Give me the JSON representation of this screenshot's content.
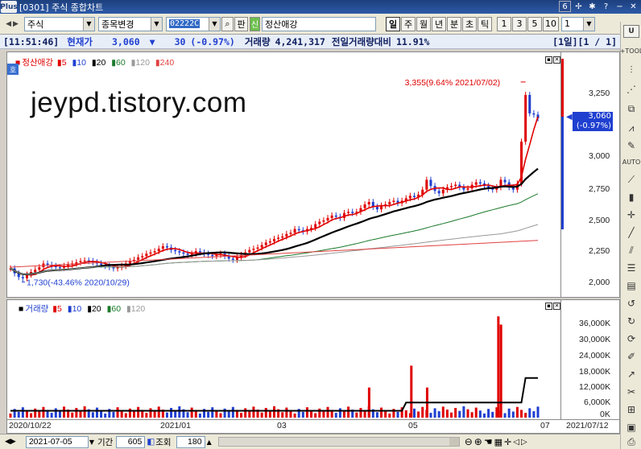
{
  "window": {
    "title": "[0301] 주식 종합차트",
    "logo": "Plus",
    "badge": "6"
  },
  "toolbar": {
    "market": "주식",
    "action": "종목변경",
    "code": "02222C",
    "pan_label": "판",
    "credit_badge": "신",
    "stock_name": "정산애강",
    "periods": [
      "일",
      "주",
      "월",
      "년",
      "분",
      "초",
      "틱"
    ],
    "active_period": "일",
    "multipliers": [
      "1",
      "3",
      "5",
      "10"
    ],
    "unit_value": "1"
  },
  "infobar": {
    "time": "[11:51:46]",
    "price_label": "현재가",
    "price": "3,060",
    "arrow": "▼",
    "change": "30",
    "change_pct": "(-0.97%)",
    "volume_label": "거래량",
    "volume": "4,241,317",
    "prev_ratio_label": "전일거래량대비",
    "prev_ratio": "11.91%",
    "page": "[1일][1 / 1]"
  },
  "price_panel": {
    "side_tag": "호",
    "legend_name": "정산애강",
    "ma": [
      {
        "label": "5",
        "color": "#e00000"
      },
      {
        "label": "10",
        "color": "#1f3fd0"
      },
      {
        "label": "20",
        "color": "#000000"
      },
      {
        "label": "60",
        "color": "#1a7a2a"
      },
      {
        "label": "120",
        "color": "#999999"
      },
      {
        "label": "240",
        "color": "#e04040"
      }
    ],
    "watermark": "jeypd.tistory.com",
    "high_annotation": "3,355(9.64% 2021/07/02)",
    "low_annotation": "1,730(-43.46% 2020/10/29)",
    "current_price_tag": "3,060",
    "current_pct_tag": "(-0.97%)",
    "y_ticks": [
      "3,250",
      "3,000",
      "2,750",
      "2,500",
      "2,250",
      "2,000",
      "1,750"
    ]
  },
  "volume_panel": {
    "legend_name": "거래량",
    "ma": [
      {
        "label": "5",
        "color": "#e00000"
      },
      {
        "label": "10",
        "color": "#1f3fd0"
      },
      {
        "label": "20",
        "color": "#000000"
      },
      {
        "label": "60",
        "color": "#1a7a2a"
      },
      {
        "label": "120",
        "color": "#999999"
      }
    ],
    "y_ticks": [
      "36,000K",
      "30,000K",
      "24,000K",
      "18,000K",
      "12,000K",
      "6,000K",
      "0K"
    ]
  },
  "x_axis": {
    "labels": [
      "2020/10/22",
      "2021/01",
      "03",
      "05",
      "07",
      "2021/07/12"
    ]
  },
  "bottombar": {
    "date": "2021-07-05",
    "period_label": "기간",
    "period_value": "605",
    "query_label": "조회",
    "query_value": "180"
  },
  "chart_data": {
    "type": "candlestick",
    "title": "정산애강",
    "x_range": [
      "2020/10/22",
      "2021/07/12"
    ],
    "ylim": [
      1700,
      3400
    ],
    "current_price": 3060,
    "high": {
      "value": 3355,
      "pct": 9.64,
      "date": "2021/07/02"
    },
    "low": {
      "value": 1730,
      "pct": -43.46,
      "date": "2020/10/29"
    },
    "closes": [
      1840,
      1800,
      1770,
      1760,
      1790,
      1810,
      1830,
      1850,
      1880,
      1870,
      1860,
      1850,
      1845,
      1860,
      1870,
      1880,
      1890,
      1900,
      1905,
      1900,
      1890,
      1880,
      1870,
      1860,
      1850,
      1840,
      1850,
      1860,
      1880,
      1900,
      1910,
      1930,
      1940,
      1960,
      1970,
      1980,
      2000,
      2020,
      2010,
      1990,
      1980,
      1970,
      1960,
      1950,
      1960,
      1980,
      1970,
      1960,
      1950,
      1940,
      1950,
      1960,
      1940,
      1920,
      1910,
      1930,
      1950,
      1970,
      1990,
      2000,
      2010,
      2030,
      2050,
      2060,
      2080,
      2090,
      2100,
      2120,
      2130,
      2160,
      2150,
      2140,
      2160,
      2170,
      2200,
      2220,
      2230,
      2250,
      2270,
      2260,
      2250,
      2290,
      2300,
      2290,
      2300,
      2330,
      2360,
      2380,
      2340,
      2320,
      2350,
      2360,
      2380,
      2390,
      2370,
      2390,
      2410,
      2430,
      2420,
      2440,
      2480,
      2560,
      2510,
      2470,
      2450,
      2480,
      2500,
      2510,
      2520,
      2500,
      2480,
      2490,
      2520,
      2540,
      2530,
      2510,
      2490,
      2480,
      2500,
      2560,
      2540,
      2500,
      2480,
      2530,
      2870,
      3250,
      3100,
      3090,
      3060
    ],
    "volume_spikes_k": [
      {
        "x": 0.68,
        "value": 11000
      },
      {
        "x": 0.76,
        "value": 19000
      },
      {
        "x": 0.79,
        "value": 11000
      },
      {
        "x": 0.925,
        "value": 37000
      },
      {
        "x": 0.93,
        "value": 34000
      }
    ]
  }
}
